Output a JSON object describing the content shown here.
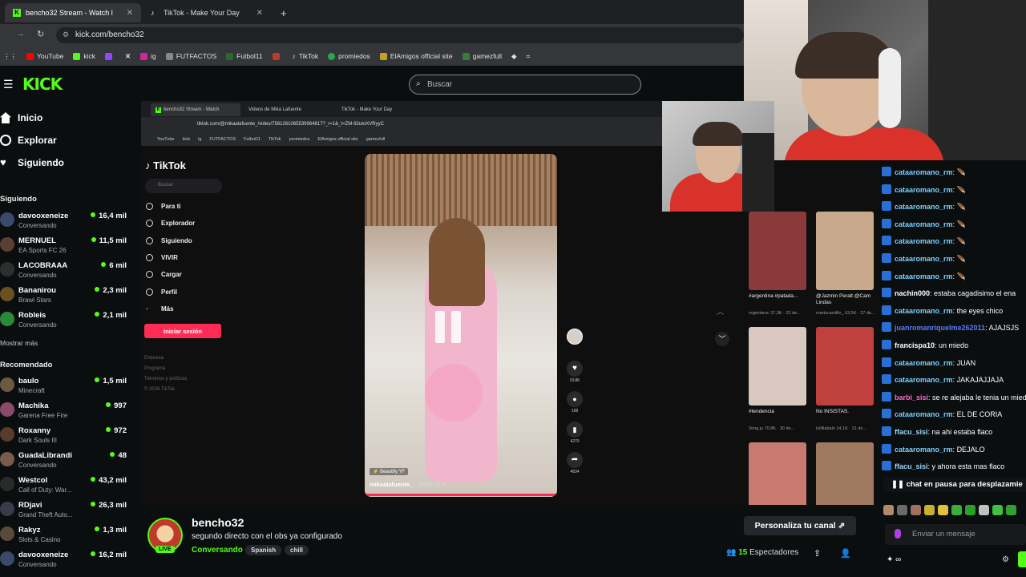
{
  "browser": {
    "tabs": [
      {
        "label": "bencho32 Stream - Watch l",
        "favicon": "kick-favicon",
        "active": true
      },
      {
        "label": "TikTok - Make Your Day",
        "favicon": "tiktok-favicon",
        "active": false
      }
    ],
    "url": "kick.com/bencho32",
    "bookmarks": [
      "YouTube",
      "kick",
      "ig",
      "FUTFACTOS",
      "Futbol11",
      "TikTok",
      "promiedos",
      "ElAmigos official site",
      "gamezfull"
    ]
  },
  "kick": {
    "logo": "KICK",
    "search_placeholder": "Buscar",
    "nav": [
      "Inicio",
      "Explorar",
      "Siguiendo"
    ],
    "following_title": "Siguiendo",
    "following": [
      {
        "name": "davooxeneize",
        "game": "Conversando",
        "viewers": "16,4 mil",
        "color": "#3b4a6b"
      },
      {
        "name": "MERNUEL",
        "game": "EA Sports FC 26",
        "viewers": "11,5 mil",
        "color": "#5a4030"
      },
      {
        "name": "LACOBRAAA",
        "game": "Conversando",
        "viewers": "6 mil",
        "color": "#2e2e2e"
      },
      {
        "name": "Bananirou",
        "game": "Brawl Stars",
        "viewers": "2,3 mil",
        "color": "#6b5020"
      },
      {
        "name": "Robleis",
        "game": "Conversando",
        "viewers": "2,1 mil",
        "color": "#2a8a3a"
      }
    ],
    "show_more": "Mostrar más",
    "recommended_title": "Recomendado",
    "recommended": [
      {
        "name": "baulo",
        "game": "Minecraft",
        "viewers": "1,5 mil",
        "color": "#6a5a40"
      },
      {
        "name": "Machika",
        "game": "Garena Free Fire",
        "viewers": "997",
        "color": "#8a4a6a"
      },
      {
        "name": "Roxanny",
        "game": "Dark Souls III",
        "viewers": "972",
        "color": "#5a3a2a"
      },
      {
        "name": "GuadaLibrandi",
        "game": "Conversando",
        "viewers": "48",
        "color": "#7a5a4a"
      },
      {
        "name": "Westcol",
        "game": "Call of Duty: War...",
        "viewers": "43,2 mil",
        "color": "#2a2a2a"
      },
      {
        "name": "RDjavi",
        "game": "Grand Theft Auto...",
        "viewers": "26,3 mil",
        "color": "#3a3a4a"
      },
      {
        "name": "Rakyz",
        "game": "Slots & Casino",
        "viewers": "1,3 mil",
        "color": "#5a4a3a"
      },
      {
        "name": "davooxeneize",
        "game": "Conversando",
        "viewers": "16,2 mil",
        "color": "#3b4a6b"
      }
    ]
  },
  "inner_browser": {
    "tabs": [
      "bencho32 Stream - Watch",
      "Videos de Mika Lafuente",
      "TikTok - Make Your Day"
    ],
    "url": "tiktok.com/@mikaalafuente_/video/7581261065539964817?_r=1&_t=ZM-92utoXVRyyC",
    "bookmarks": [
      "YouTube",
      "kick",
      "ig",
      "FUTFACTOS",
      "Futbol11",
      "TikTok",
      "promiedos",
      "ElAmigos official site",
      "gamezfull"
    ]
  },
  "tiktok": {
    "logo": "TikTok",
    "search_placeholder": "Buscar",
    "nav": [
      "Para ti",
      "Explorador",
      "Siguiendo",
      "VIVIR",
      "Cargar",
      "Perfil",
      "Más"
    ],
    "login": "Iniciar sesión",
    "footer": [
      "Empresa",
      "Programa",
      "Términos y políticas",
      "© 2026 TikTok"
    ],
    "video_author": "mikaalafuente_",
    "video_date": "· 2025-12-7",
    "video_tag": "Beautify YF",
    "counts": [
      "19,8K",
      "108",
      "4270",
      "4834"
    ],
    "thumbnails": [
      {
        "caption": "#argentina #patada...",
        "sub": "reginitaroc  37,3K · 22 de...",
        "color": "#8a3a3a"
      },
      {
        "caption": "@Jazmin Peralt @Cam Lindas",
        "sub": "martucardillo_  63,5K · 27 de...",
        "color": "#c9a98c"
      },
      {
        "caption": "#tendencia",
        "sub": "3ong.ju  70,8K · 30 de...",
        "color": "#d8c8c0"
      },
      {
        "caption": "No INSISTAS.",
        "sub": "lulililabalo  14,1K · 31 de...",
        "color": "#c04040"
      },
      {
        "caption": "",
        "sub": "",
        "color": "#c87a70"
      },
      {
        "caption": "",
        "sub": "",
        "color": "#a07a60"
      }
    ]
  },
  "chat": {
    "messages": [
      {
        "user": "cataaromano_rm",
        "text": "🪶",
        "color": "#7ad0ff"
      },
      {
        "user": "cataaromano_rm",
        "text": "🪶",
        "color": "#7ad0ff"
      },
      {
        "user": "cataaromano_rm",
        "text": "🪶",
        "color": "#7ad0ff"
      },
      {
        "user": "cataaromano_rm",
        "text": "🪶",
        "color": "#7ad0ff"
      },
      {
        "user": "cataaromano_rm",
        "text": "🪶",
        "color": "#7ad0ff"
      },
      {
        "user": "cataaromano_rm",
        "text": "🪶",
        "color": "#7ad0ff"
      },
      {
        "user": "cataaromano_rm",
        "text": "🪶",
        "color": "#7ad0ff"
      },
      {
        "user": "nachin000",
        "text": "estaba cagadisimo el ena",
        "color": "#ffffff"
      },
      {
        "user": "cataaromano_rm",
        "text": "the eyes chico",
        "color": "#7ad0ff"
      },
      {
        "user": "juanromanriquelme262011",
        "text": "AJAJSJS",
        "color": "#5a7aff"
      },
      {
        "user": "francispa10",
        "text": "un miedo",
        "color": "#ffffff"
      },
      {
        "user": "cataaromano_rm",
        "text": "JUAN",
        "color": "#7ad0ff"
      },
      {
        "user": "cataaromano_rm",
        "text": "JAKAJAJJAJA",
        "color": "#7ad0ff"
      },
      {
        "user": "barbi_sisi",
        "text": "se re alejaba le tenia un miedo",
        "color": "#ff66cc"
      },
      {
        "user": "cataaromano_rm",
        "text": "EL DE CORIA",
        "color": "#7ad0ff"
      },
      {
        "user": "ffacu_sisi",
        "text": "na ahi estaba flaco",
        "color": "#9ad8ff"
      },
      {
        "user": "cataaromano_rm",
        "text": "DEJALO",
        "color": "#7ad0ff"
      },
      {
        "user": "ffacu_sisi",
        "text": "y ahora esta mas flaco",
        "color": "#9ad8ff"
      }
    ],
    "paused": "chat en pausa para desplazamie",
    "input_placeholder": "Enviar un mensaje"
  },
  "channel": {
    "name": "bencho32",
    "title": "segundo directo con el obs ya configurado",
    "live": "LIVE",
    "category": "Conversando",
    "tags": [
      "Spanish",
      "chill"
    ],
    "customize": "Personaliza tu canal",
    "viewers_count": "15",
    "viewers_label": "Espectadores"
  },
  "colors": {
    "kick_green": "#53fc18",
    "tiktok_red": "#fe2c55",
    "bg": "#0b0e0f"
  }
}
